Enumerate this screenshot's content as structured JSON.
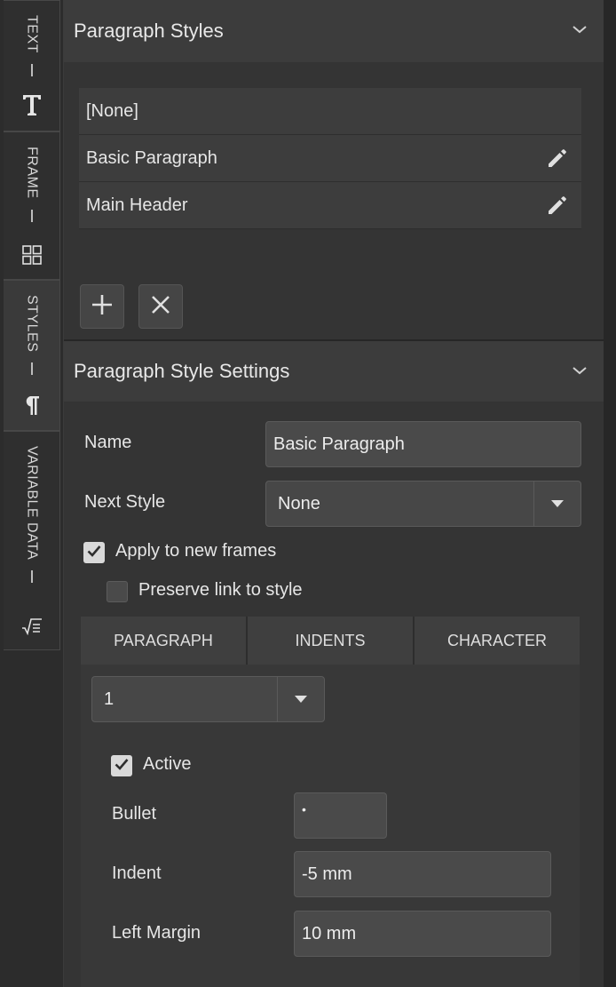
{
  "rail": {
    "tabs": [
      {
        "label": "TEXT",
        "icon": "text-icon"
      },
      {
        "label": "FRAME",
        "icon": "grid-icon"
      },
      {
        "label": "STYLES",
        "icon": "pilcrow-icon"
      },
      {
        "label": "VARIABLE DATA",
        "icon": "formula-icon"
      }
    ],
    "active": "STYLES"
  },
  "paragraph_styles": {
    "title": "Paragraph Styles",
    "items": [
      {
        "label": "[None]",
        "editable": false
      },
      {
        "label": "Basic Paragraph",
        "editable": true
      },
      {
        "label": "Main Header",
        "editable": true
      }
    ]
  },
  "settings": {
    "title": "Paragraph Style Settings",
    "name_label": "Name",
    "name_value": "Basic Paragraph",
    "next_style_label": "Next Style",
    "next_style_value": "None",
    "apply_label": "Apply to new frames",
    "apply_checked": true,
    "preserve_label": "Preserve link to style",
    "preserve_checked": false,
    "tabs": [
      "PARAGRAPH",
      "INDENTS",
      "CHARACTER"
    ],
    "level_value": "1",
    "active_label": "Active",
    "active_checked": true,
    "bullet_label": "Bullet",
    "bullet_value": "•",
    "indent_label": "Indent",
    "indent_value": "-5 mm",
    "left_margin_label": "Left Margin",
    "left_margin_value": "10 mm"
  },
  "colors": {
    "panel": "#343434",
    "header": "#3c3c3c",
    "field": "#4a4a4a",
    "text": "#e6e6e6"
  }
}
